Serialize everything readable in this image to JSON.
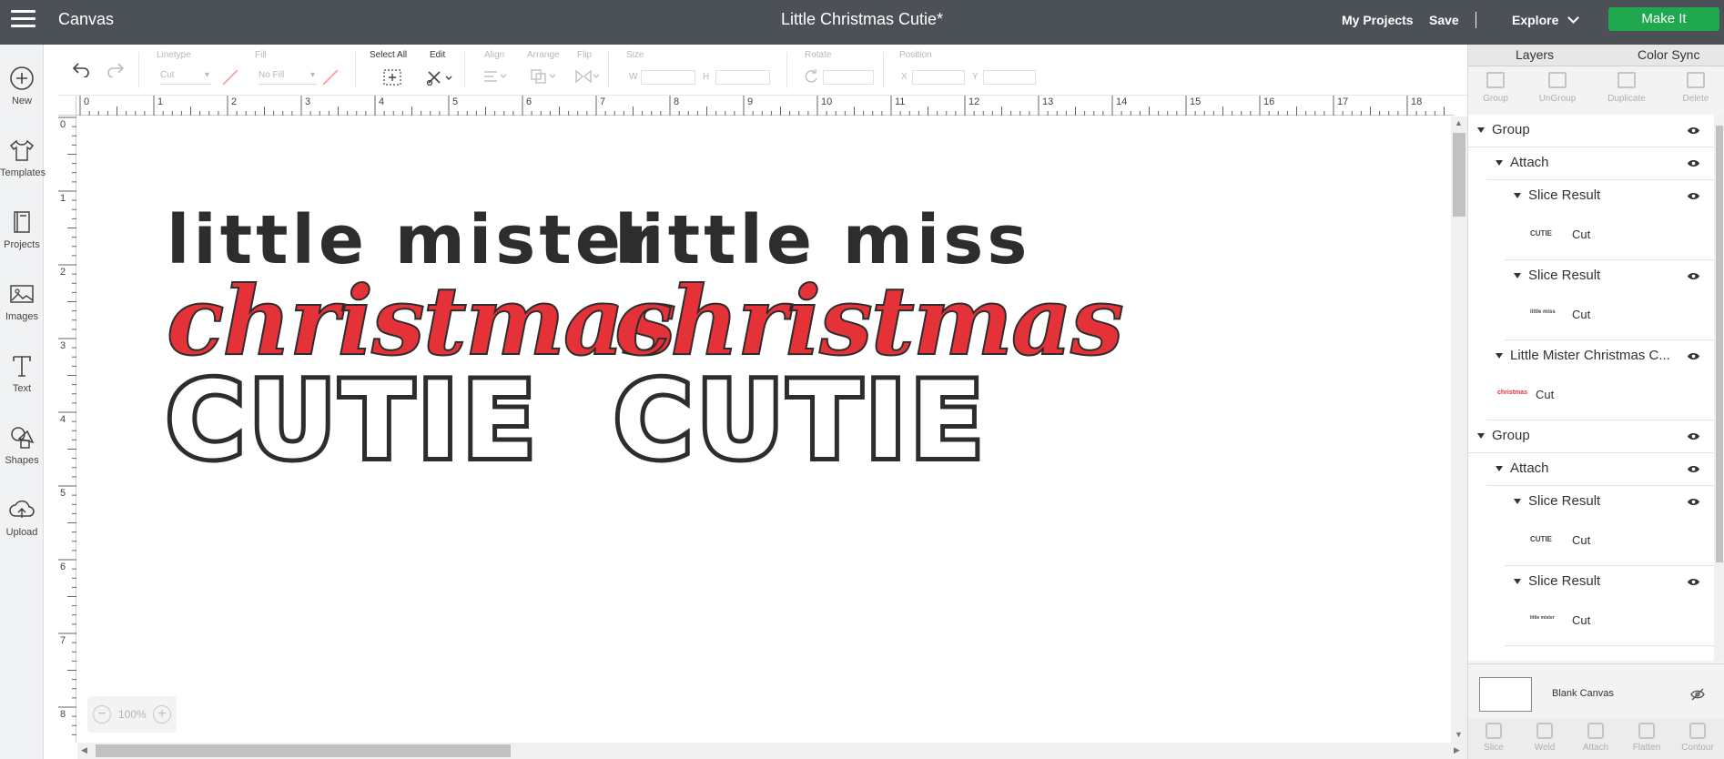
{
  "topbar": {
    "app_title": "Canvas",
    "doc_title": "Little Christmas Cutie*",
    "my_projects": "My Projects",
    "save": "Save",
    "explore": "Explore",
    "make_it": "Make It"
  },
  "sidebar": {
    "items": [
      {
        "label": "New",
        "icon": "plus-circle-icon"
      },
      {
        "label": "Templates",
        "icon": "tshirt-icon"
      },
      {
        "label": "Projects",
        "icon": "book-icon"
      },
      {
        "label": "Images",
        "icon": "image-icon"
      },
      {
        "label": "Text",
        "icon": "text-icon"
      },
      {
        "label": "Shapes",
        "icon": "shapes-icon"
      },
      {
        "label": "Upload",
        "icon": "cloud-upload-icon"
      }
    ]
  },
  "toolbar": {
    "linetype_label": "Linetype",
    "linetype_value": "Cut",
    "fill_label": "Fill",
    "fill_value": "No Fill",
    "select_all": "Select All",
    "edit": "Edit",
    "align": "Align",
    "arrange": "Arrange",
    "flip": "Flip",
    "size": "Size",
    "w": "W",
    "h": "H",
    "rotate": "Rotate",
    "position": "Position",
    "x": "X",
    "y": "Y"
  },
  "ruler": {
    "top": [
      "0",
      "1",
      "2",
      "3",
      "4",
      "5",
      "6",
      "7",
      "8",
      "9",
      "10",
      "11",
      "12",
      "13",
      "14",
      "15",
      "16",
      "17",
      "18"
    ],
    "left": [
      "0",
      "1",
      "2",
      "3",
      "4",
      "5",
      "6",
      "7",
      "8"
    ]
  },
  "canvas": {
    "design1": {
      "line1": "little mister",
      "line2": "christmas",
      "line3": "CUTIE"
    },
    "design2": {
      "line1": "little miss",
      "line2": "christmas",
      "line3": "CUTIE"
    },
    "zoom": "100%"
  },
  "panel": {
    "tabs": [
      "Layers",
      "Color Sync"
    ],
    "tools": [
      "Group",
      "UnGroup",
      "Duplicate",
      "Delete"
    ],
    "layers": [
      {
        "label": "Group"
      },
      {
        "label": "Attach"
      },
      {
        "label": "Slice Result"
      },
      {
        "label": "Cut",
        "thumb": "CUTIE"
      },
      {
        "label": "Slice Result"
      },
      {
        "label": "Cut",
        "thumb": "little miss"
      },
      {
        "label": "Little Mister Christmas C..."
      },
      {
        "label": "Cut",
        "thumb": "christmas"
      },
      {
        "label": "Group"
      },
      {
        "label": "Attach"
      },
      {
        "label": "Slice Result"
      },
      {
        "label": "Cut",
        "thumb": "CUTIE"
      },
      {
        "label": "Slice Result"
      },
      {
        "label": "Cut",
        "thumb": "little mister"
      }
    ],
    "blank_canvas": "Blank Canvas",
    "bottom_tools": [
      "Slice",
      "Weld",
      "Attach",
      "Flatten",
      "Contour"
    ]
  },
  "colors": {
    "topbar": "#4b5157",
    "make_it": "#1fa84e",
    "christmas_red": "#e53238",
    "ink": "#2d2d2d"
  }
}
